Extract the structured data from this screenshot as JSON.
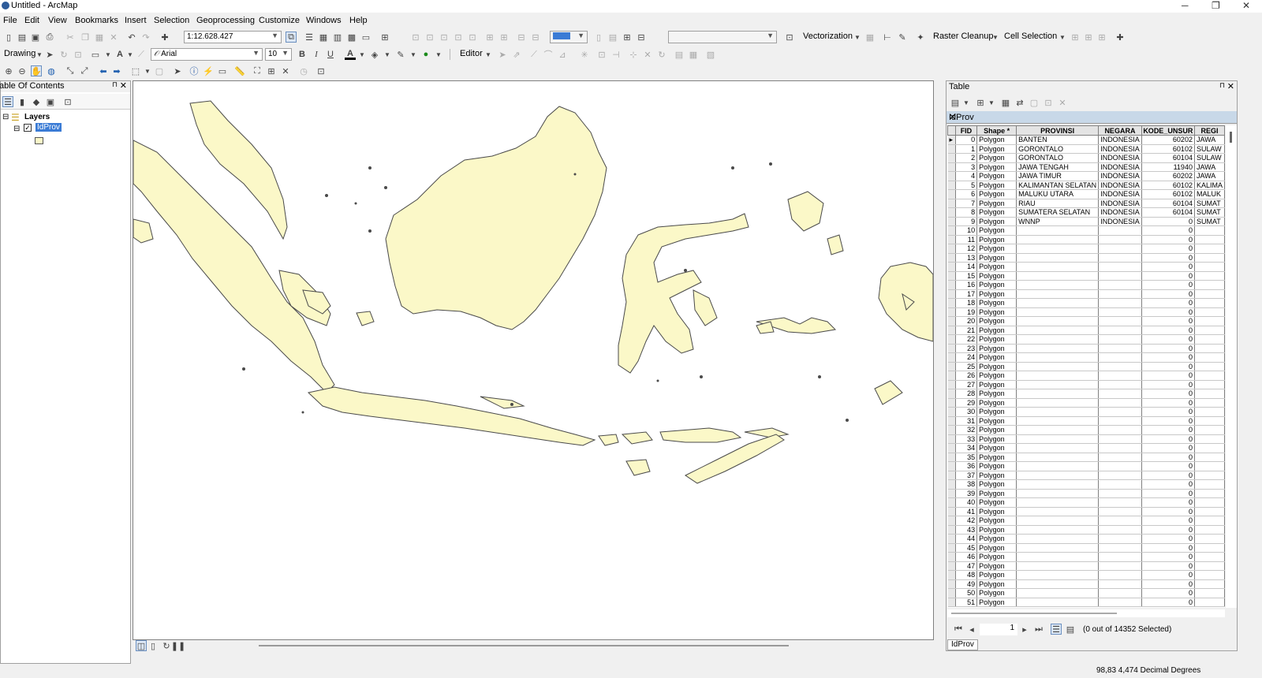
{
  "window": {
    "title": "Untitled - ArcMap",
    "min": "─",
    "max": "❐",
    "close": "✕"
  },
  "menu": [
    "File",
    "Edit",
    "View",
    "Bookmarks",
    "Insert",
    "Selection",
    "Geoprocessing",
    "Customize",
    "Windows",
    "Help"
  ],
  "toolbar": {
    "scale": "1:12.628.427",
    "drawing_label": "Drawing",
    "font_name": "Arial",
    "font_size": "10",
    "bold": "B",
    "italic": "I",
    "underline": "U",
    "editor_label": "Editor",
    "vectorization_label": "Vectorization",
    "raster_cleanup_label": "Raster Cleanup",
    "cell_selection_label": "Cell Selection"
  },
  "toc": {
    "title": "able Of Contents",
    "root": "Layers",
    "layer": "IdProv",
    "expand_root": "⊟",
    "expand_layer": "⊟"
  },
  "table": {
    "title": "Table",
    "tab_name": "IdProv",
    "columns": [
      "FID",
      "Shape *",
      "PROVINSI",
      "NEGARA",
      "KODE_UNSUR",
      "REGI"
    ],
    "rows": [
      [
        "0",
        "Polygon",
        "BANTEN",
        "INDONESIA",
        "60202",
        "JAWA"
      ],
      [
        "1",
        "Polygon",
        "GORONTALO",
        "INDONESIA",
        "60102",
        "SULAW"
      ],
      [
        "2",
        "Polygon",
        "GORONTALO",
        "INDONESIA",
        "60104",
        "SULAW"
      ],
      [
        "3",
        "Polygon",
        "JAWA TENGAH",
        "INDONESIA",
        "11940",
        "JAWA"
      ],
      [
        "4",
        "Polygon",
        "JAWA TIMUR",
        "INDONESIA",
        "60202",
        "JAWA"
      ],
      [
        "5",
        "Polygon",
        "KALIMANTAN SELATAN",
        "INDONESIA",
        "60102",
        "KALIMA"
      ],
      [
        "6",
        "Polygon",
        "MALUKU UTARA",
        "INDONESIA",
        "60102",
        "MALUK"
      ],
      [
        "7",
        "Polygon",
        "RIAU",
        "INDONESIA",
        "60104",
        "SUMAT"
      ],
      [
        "8",
        "Polygon",
        "SUMATERA SELATAN",
        "INDONESIA",
        "60104",
        "SUMAT"
      ],
      [
        "9",
        "Polygon",
        "WNNP",
        "INDONESIA",
        "0",
        "SUMAT"
      ],
      [
        "10",
        "Polygon",
        "",
        "",
        "0",
        ""
      ],
      [
        "11",
        "Polygon",
        "",
        "",
        "0",
        ""
      ],
      [
        "12",
        "Polygon",
        "",
        "",
        "0",
        ""
      ],
      [
        "13",
        "Polygon",
        "",
        "",
        "0",
        ""
      ],
      [
        "14",
        "Polygon",
        "",
        "",
        "0",
        ""
      ],
      [
        "15",
        "Polygon",
        "",
        "",
        "0",
        ""
      ],
      [
        "16",
        "Polygon",
        "",
        "",
        "0",
        ""
      ],
      [
        "17",
        "Polygon",
        "",
        "",
        "0",
        ""
      ],
      [
        "18",
        "Polygon",
        "",
        "",
        "0",
        ""
      ],
      [
        "19",
        "Polygon",
        "",
        "",
        "0",
        ""
      ],
      [
        "20",
        "Polygon",
        "",
        "",
        "0",
        ""
      ],
      [
        "21",
        "Polygon",
        "",
        "",
        "0",
        ""
      ],
      [
        "22",
        "Polygon",
        "",
        "",
        "0",
        ""
      ],
      [
        "23",
        "Polygon",
        "",
        "",
        "0",
        ""
      ],
      [
        "24",
        "Polygon",
        "",
        "",
        "0",
        ""
      ],
      [
        "25",
        "Polygon",
        "",
        "",
        "0",
        ""
      ],
      [
        "26",
        "Polygon",
        "",
        "",
        "0",
        ""
      ],
      [
        "27",
        "Polygon",
        "",
        "",
        "0",
        ""
      ],
      [
        "28",
        "Polygon",
        "",
        "",
        "0",
        ""
      ],
      [
        "29",
        "Polygon",
        "",
        "",
        "0",
        ""
      ],
      [
        "30",
        "Polygon",
        "",
        "",
        "0",
        ""
      ],
      [
        "31",
        "Polygon",
        "",
        "",
        "0",
        ""
      ],
      [
        "32",
        "Polygon",
        "",
        "",
        "0",
        ""
      ],
      [
        "33",
        "Polygon",
        "",
        "",
        "0",
        ""
      ],
      [
        "34",
        "Polygon",
        "",
        "",
        "0",
        ""
      ],
      [
        "35",
        "Polygon",
        "",
        "",
        "0",
        ""
      ],
      [
        "36",
        "Polygon",
        "",
        "",
        "0",
        ""
      ],
      [
        "37",
        "Polygon",
        "",
        "",
        "0",
        ""
      ],
      [
        "38",
        "Polygon",
        "",
        "",
        "0",
        ""
      ],
      [
        "39",
        "Polygon",
        "",
        "",
        "0",
        ""
      ],
      [
        "40",
        "Polygon",
        "",
        "",
        "0",
        ""
      ],
      [
        "41",
        "Polygon",
        "",
        "",
        "0",
        ""
      ],
      [
        "42",
        "Polygon",
        "",
        "",
        "0",
        ""
      ],
      [
        "43",
        "Polygon",
        "",
        "",
        "0",
        ""
      ],
      [
        "44",
        "Polygon",
        "",
        "",
        "0",
        ""
      ],
      [
        "45",
        "Polygon",
        "",
        "",
        "0",
        ""
      ],
      [
        "46",
        "Polygon",
        "",
        "",
        "0",
        ""
      ],
      [
        "47",
        "Polygon",
        "",
        "",
        "0",
        ""
      ],
      [
        "48",
        "Polygon",
        "",
        "",
        "0",
        ""
      ],
      [
        "49",
        "Polygon",
        "",
        "",
        "0",
        ""
      ],
      [
        "50",
        "Polygon",
        "",
        "",
        "0",
        ""
      ],
      [
        "51",
        "Polygon",
        "",
        "",
        "0",
        ""
      ]
    ],
    "nav_record": "1",
    "selection_status": "(0 out of 14352 Selected)",
    "bottom_tab": "IdProv"
  },
  "status": {
    "coords": "98,83  4,474 Decimal Degrees"
  },
  "colors": {
    "land_fill": "#fbf8c8",
    "land_stroke": "#4a4a4a",
    "layer_highlight": "#3a7bd5",
    "tab_bar": "#c8d8e8"
  }
}
